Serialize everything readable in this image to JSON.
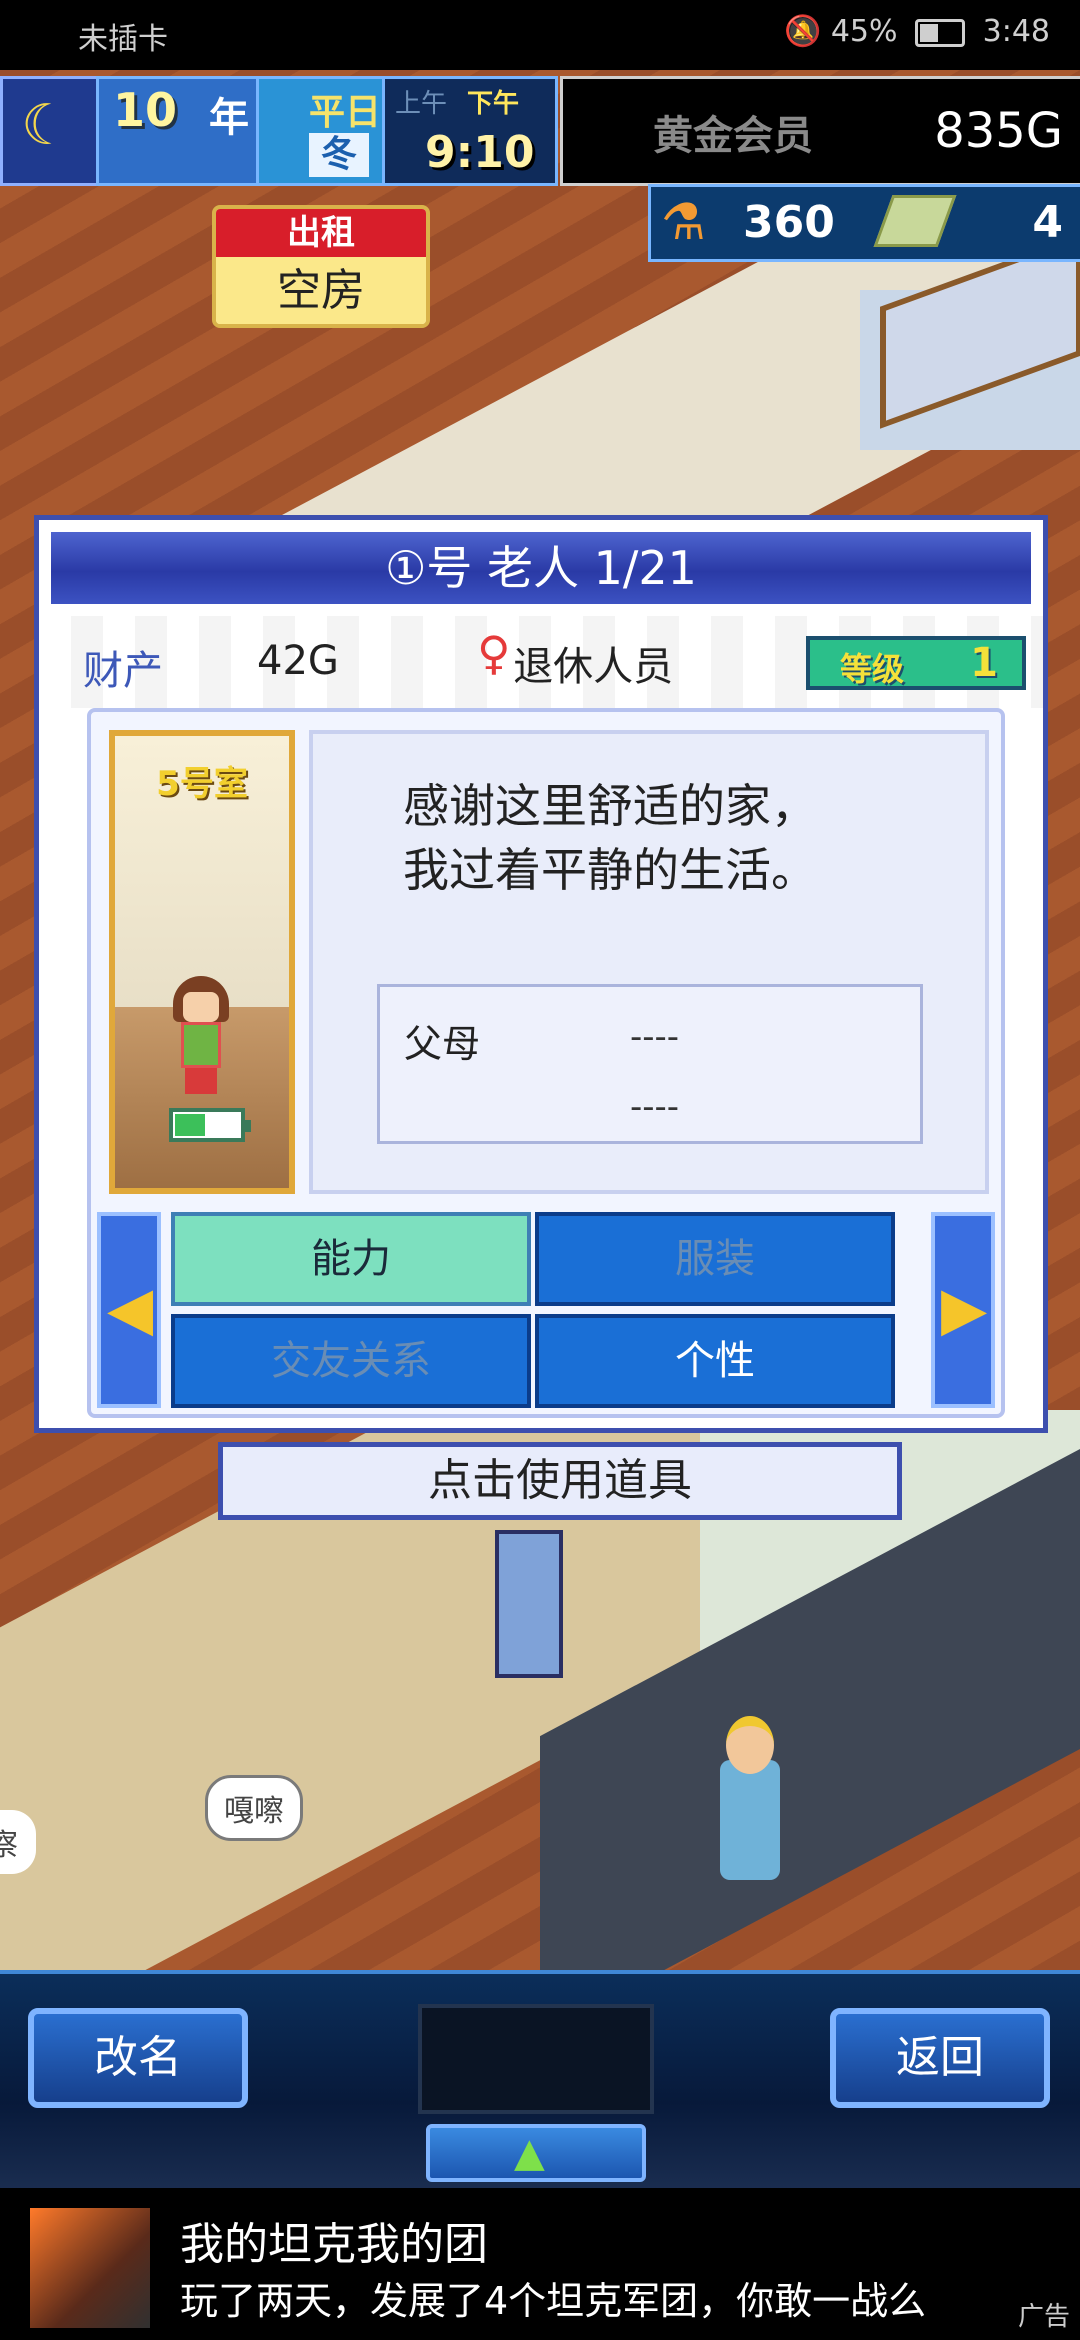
{
  "status_bar": {
    "carrier": "未插卡",
    "battery_percent": "45%",
    "time": "3:48"
  },
  "hud": {
    "year": "10",
    "year_unit": "年",
    "day_type": "平日",
    "season": "冬",
    "am_label": "上午",
    "pm_label": "下午",
    "clock": "9:10",
    "membership_label": "黄金会员",
    "money": "835G",
    "research_points": "360",
    "ticket_count": "4"
  },
  "rent_sign": {
    "top": "出租",
    "bottom": "空房"
  },
  "dialog": {
    "title": "①号 老人 1/21",
    "asset_label": "财产",
    "asset_value": "42G",
    "occupation": "退休人员",
    "level_label": "等级",
    "level_value": "1",
    "room": "5号室",
    "message_line1": "感谢这里舒适的家，",
    "message_line2": "我过着平静的生活。",
    "parents_label": "父母",
    "parent1": "----",
    "parent2": "----",
    "tabs": [
      {
        "label": "能力"
      },
      {
        "label": "服装"
      },
      {
        "label": "交友关系"
      },
      {
        "label": "个性"
      }
    ],
    "use_item": "点击使用道具"
  },
  "world": {
    "bubble_text": "嘎嚓",
    "bubble_text_2": "察"
  },
  "bottom_bar": {
    "rename": "改名",
    "back": "返回"
  },
  "ad": {
    "title": "我的坦克我的团",
    "desc": "玩了两天，发展了4个坦克军团，你敢一战么",
    "tag": "广告"
  }
}
